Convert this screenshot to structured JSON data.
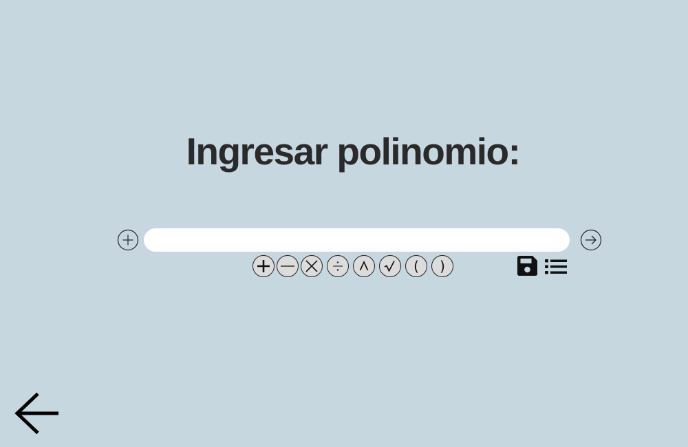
{
  "page": {
    "title": "Ingresar polinomio:"
  },
  "input": {
    "value": "",
    "placeholder": ""
  },
  "operators": {
    "lparen": "(",
    "rparen": ")"
  },
  "icons": {
    "add": "circle-plus-icon",
    "submit": "circle-arrow-right-icon",
    "plus": "plus-icon",
    "minus": "minus-icon",
    "times": "times-icon",
    "divide": "divide-icon",
    "power": "caret-icon",
    "sqrt": "sqrt-icon",
    "save": "floppy-disk-icon",
    "list": "list-icon",
    "back": "arrow-left-icon"
  },
  "colors": {
    "background": "#c7d7e0",
    "title": "#2a2a2a",
    "input_bg": "#ffffff",
    "operator_bg": "#dcdcdc",
    "icon": "#111111"
  }
}
